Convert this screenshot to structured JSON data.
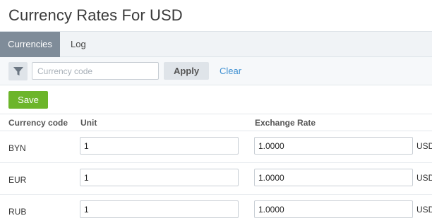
{
  "page": {
    "title": "Currency Rates For USD"
  },
  "tabs": [
    {
      "label": "Currencies",
      "active": true
    },
    {
      "label": "Log",
      "active": false
    }
  ],
  "filter": {
    "icon": "filter-icon",
    "placeholder": "Currency code",
    "value": "",
    "apply_label": "Apply",
    "clear_label": "Clear"
  },
  "actions": {
    "save_label": "Save",
    "save_color": "#6cb52a"
  },
  "table": {
    "columns": [
      "Currency code",
      "Unit",
      "Exchange Rate"
    ],
    "rows": [
      {
        "code": "BYN",
        "unit": "1",
        "rate": "1.0000",
        "suffix": "USD"
      },
      {
        "code": "EUR",
        "unit": "1",
        "rate": "1.0000",
        "suffix": "USD"
      },
      {
        "code": "RUB",
        "unit": "1",
        "rate": "1.0000",
        "suffix": "USD"
      }
    ]
  },
  "colors": {
    "tab_active_bg": "#7f8c99",
    "link": "#3d8fd1"
  }
}
